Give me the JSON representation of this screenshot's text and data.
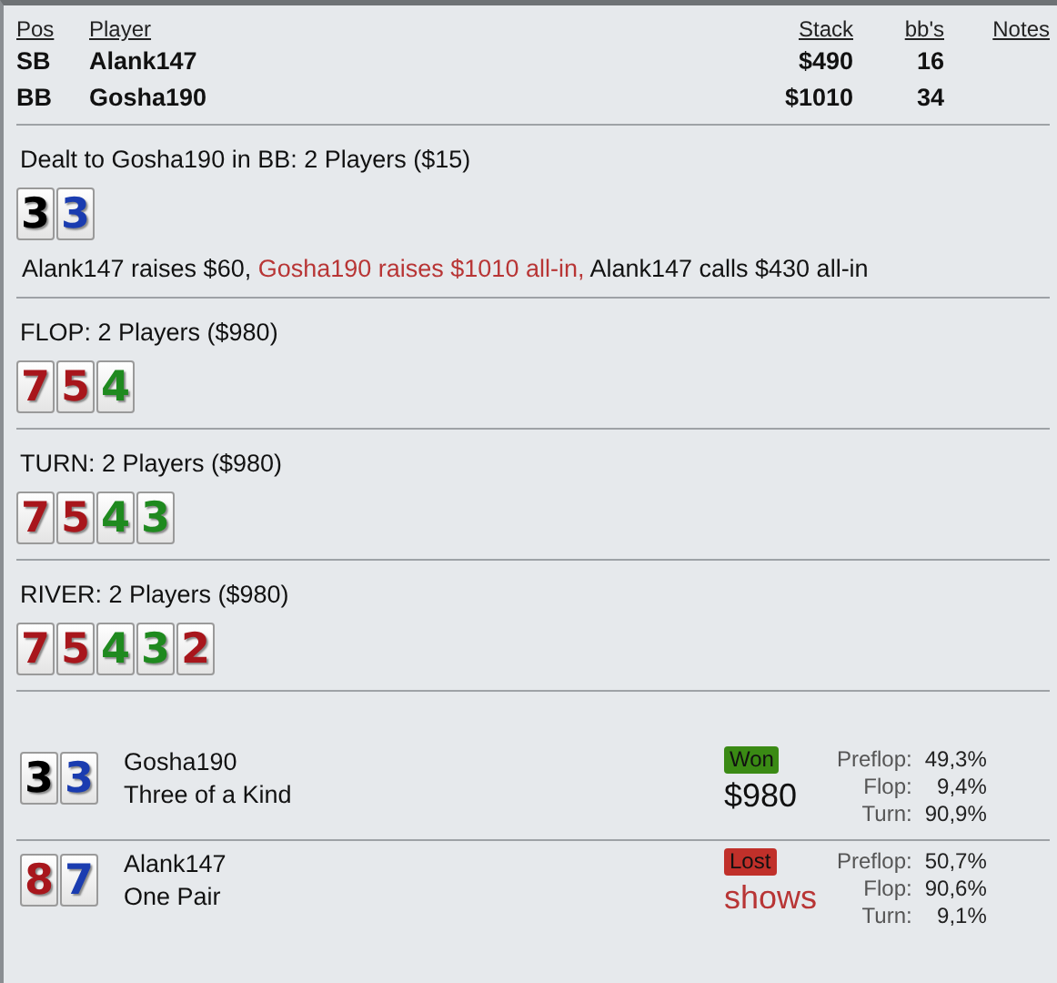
{
  "players_table": {
    "columns": [
      "Pos",
      "Player",
      "Stack",
      "bb's",
      "Notes"
    ],
    "rows": [
      {
        "pos": "SB",
        "player": "Alank147",
        "stack": "$490",
        "bbs": "16"
      },
      {
        "pos": "BB",
        "player": "Gosha190",
        "stack": "$1010",
        "bbs": "34"
      }
    ]
  },
  "streets": [
    {
      "title": "Dealt to Gosha190 in BB: 2 Players ($15)",
      "cards": [
        {
          "rank": "3",
          "color": "#000000"
        },
        {
          "rank": "3",
          "color": "#1a3cb0"
        }
      ],
      "action": [
        {
          "text": "Alank147 raises $60, ",
          "highlight": false
        },
        {
          "text": "Gosha190 raises $1010 all-in,",
          "highlight": true
        },
        {
          "text": " Alank147 calls $430 all-in",
          "highlight": false
        }
      ]
    },
    {
      "title": "FLOP: 2 Players ($980)",
      "cards": [
        {
          "rank": "7",
          "color": "#a8161c"
        },
        {
          "rank": "5",
          "color": "#a8161c"
        },
        {
          "rank": "4",
          "color": "#1f8a1f"
        }
      ]
    },
    {
      "title": "TURN: 2 Players ($980)",
      "cards": [
        {
          "rank": "7",
          "color": "#a8161c"
        },
        {
          "rank": "5",
          "color": "#a8161c"
        },
        {
          "rank": "4",
          "color": "#1f8a1f"
        },
        {
          "rank": "3",
          "color": "#1f8a1f"
        }
      ]
    },
    {
      "title": "RIVER: 2 Players ($980)",
      "cards": [
        {
          "rank": "7",
          "color": "#a8161c"
        },
        {
          "rank": "5",
          "color": "#a8161c"
        },
        {
          "rank": "4",
          "color": "#1f8a1f"
        },
        {
          "rank": "3",
          "color": "#1f8a1f"
        },
        {
          "rank": "2",
          "color": "#a8161c"
        }
      ]
    }
  ],
  "results": [
    {
      "cards": [
        {
          "rank": "3",
          "color": "#000000"
        },
        {
          "rank": "3",
          "color": "#1a3cb0"
        }
      ],
      "player": "Gosha190",
      "hand": "Three of a Kind",
      "kind": "won",
      "badge": "Won",
      "amount": "$980",
      "equity": [
        {
          "label": "Preflop:",
          "value": "49,3%"
        },
        {
          "label": "Flop:",
          "value": "9,4%"
        },
        {
          "label": "Turn:",
          "value": "90,9%"
        }
      ]
    },
    {
      "cards": [
        {
          "rank": "8",
          "color": "#a8161c"
        },
        {
          "rank": "7",
          "color": "#1a3cb0"
        }
      ],
      "player": "Alank147",
      "hand": "One Pair",
      "kind": "lost",
      "badge": "Lost",
      "amount": "shows",
      "equity": [
        {
          "label": "Preflop:",
          "value": "50,7%"
        },
        {
          "label": "Flop:",
          "value": "90,6%"
        },
        {
          "label": "Turn:",
          "value": "9,1%"
        }
      ]
    }
  ]
}
